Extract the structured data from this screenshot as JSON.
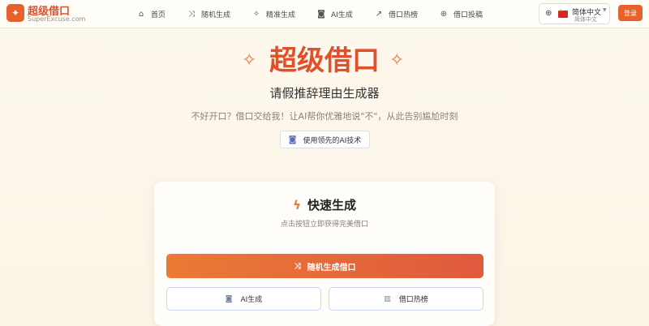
{
  "brand": {
    "name": "超级借口",
    "domain": "SuperExcuse.com",
    "logo_icon": "sparkle-icon"
  },
  "nav": [
    {
      "label": "首页",
      "icon": "home-icon",
      "glyph": "⌂"
    },
    {
      "label": "随机生成",
      "icon": "shuffle-icon",
      "glyph": "⤨"
    },
    {
      "label": "精准生成",
      "icon": "sparkles-icon",
      "glyph": "✧"
    },
    {
      "label": "AI生成",
      "icon": "bot-icon",
      "glyph": "◙"
    },
    {
      "label": "借口热榜",
      "icon": "trending-icon",
      "glyph": "↗"
    },
    {
      "label": "借口投稿",
      "icon": "plus-circle-icon",
      "glyph": "⊕"
    }
  ],
  "language": {
    "selected": "简体中文",
    "sub": "简体中文"
  },
  "login_label": "登录",
  "hero": {
    "title": "超级借口",
    "subtitle": "请假推辞理由生成器",
    "description": "不好开口？借口交给我！让AI帮你优雅地说\"不\"，从此告别尴尬时刻",
    "badge": "使用领先的AI技术"
  },
  "card": {
    "title": "快速生成",
    "subtitle": "点击按钮立即获得完美借口",
    "primary_button": "随机生成借口",
    "ai_button": "AI生成",
    "ranking_button": "借口热榜"
  },
  "colors": {
    "accent": "#e0502a",
    "gradient_start": "#ea7a35",
    "gradient_end": "#e05a3e"
  }
}
